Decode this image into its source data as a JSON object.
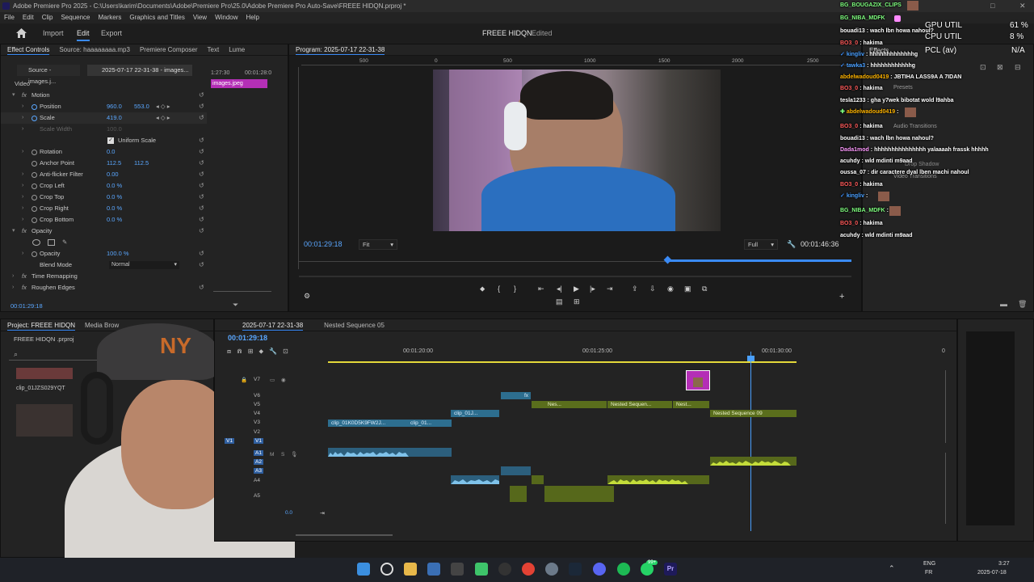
{
  "window": {
    "title": "Adobe Premiere Pro 2025 - C:\\Users\\karim\\Documents\\Adobe\\Premiere Pro\\25.0\\Adobe Premiere Pro Auto-Save\\FREEE HIDQN.prproj *"
  },
  "menu": [
    "File",
    "Edit",
    "Clip",
    "Sequence",
    "Markers",
    "Graphics and Titles",
    "View",
    "Window",
    "Help"
  ],
  "workspace": {
    "tabs": [
      "Import",
      "Edit",
      "Export"
    ],
    "active_tab": "Edit",
    "project_title": "FREEE HIDQN",
    "project_status": "Edited"
  },
  "effect_controls": {
    "tabs": [
      "Effect Controls",
      "Source: haaaaaaaa.mp3",
      "Premiere Composer",
      "Text",
      "Lume"
    ],
    "source_label": "Source - images.j...",
    "sequence_label": "2025-07-17 22-31-38 - images...",
    "ruler_times": [
      "1:27:30",
      "00:01:28:0"
    ],
    "clip_name": "images.jpeg",
    "section_video": "Video",
    "motion": "Motion",
    "rows": [
      {
        "label": "Position",
        "v1": "960.0",
        "v2": "553.0"
      },
      {
        "label": "Scale",
        "v1": "419.0",
        "v2": ""
      },
      {
        "label": "Scale Width",
        "v1": "100.0",
        "v2": ""
      },
      {
        "label": "Uniform Scale",
        "v1": "",
        "v2": ""
      },
      {
        "label": "Rotation",
        "v1": "0.0",
        "v2": ""
      },
      {
        "label": "Anchor Point",
        "v1": "112.5",
        "v2": "112.5"
      },
      {
        "label": "Anti-flicker Filter",
        "v1": "0.00",
        "v2": ""
      },
      {
        "label": "Crop Left",
        "v1": "0.0 %",
        "v2": ""
      },
      {
        "label": "Crop Top",
        "v1": "0.0 %",
        "v2": ""
      },
      {
        "label": "Crop Right",
        "v1": "0.0 %",
        "v2": ""
      },
      {
        "label": "Crop Bottom",
        "v1": "0.0 %",
        "v2": ""
      }
    ],
    "opacity_section": "Opacity",
    "opacity_label": "Opacity",
    "opacity_value": "100.0 %",
    "blend_mode_label": "Blend Mode",
    "blend_mode_value": "Normal",
    "time_remapping": "Time Remapping",
    "roughen_edges": "Roughen Edges",
    "timecode": "00:01:29:18"
  },
  "program_monitor": {
    "title": "Program: 2025-07-17 22-31-38",
    "ruler_marks": [
      "500",
      "0",
      "500",
      "1000",
      "1500",
      "2000",
      "2500"
    ],
    "timecode": "00:01:29:18",
    "fit": "Fit",
    "quality": "Full",
    "duration": "00:01:46:36"
  },
  "project_panel": {
    "tabs": [
      "Project: FREEE HIDQN",
      "Media Brow"
    ],
    "file": "FREEE HIDQN .prproj",
    "clip_label": "clip_01JZS029YQT"
  },
  "timeline": {
    "tabs": [
      "2025-07-17 22-31-38",
      "Nested Sequence 05"
    ],
    "timecode": "00:01:29:18",
    "ruler_labels": [
      "00:01:20:00",
      "00:01:25:00",
      "00:01:30:00",
      "0"
    ],
    "video_tracks": [
      "V7",
      "V6",
      "V5",
      "V4",
      "V3",
      "V2",
      "V1"
    ],
    "audio_tracks": [
      "A1",
      "A2",
      "A3",
      "A4",
      "A5"
    ],
    "master_value": "0.0",
    "clips": {
      "c1": "clip_01K0D5K9FW2J...",
      "c2": "clip_01...",
      "c3": "clip_01J...",
      "c4": "Nes...",
      "c5": "Nested Sequen...",
      "c6": "Nest...",
      "c7": "Nested Sequence 09",
      "fx": "fx"
    }
  },
  "overlay": {
    "gpu_util": "GPU UTIL",
    "gpu_val": "61 %",
    "cpu_util": "CPU UTIL",
    "cpu_val": "8 %",
    "pcl": "PCL (av)",
    "na": "N/A",
    "effects_label": "Effects",
    "presets": "Presets",
    "audio_transitions": "Audio Transitions",
    "video_transitions": "Video Transitions",
    "drop_shadow": "Drop Shadow"
  },
  "chat": [
    {
      "user": "BG_BOUGAZIX_CLIPS",
      "msg": ""
    },
    {
      "user": "BG_NIBA_MDFK",
      "msg": ""
    },
    {
      "user": "bouadi13",
      "msg": ": wach lbn howa nahoul?"
    },
    {
      "user": "BO3_0",
      "msg": ": hakima"
    },
    {
      "user": "kingliv",
      "msg": ": hhhhhhhhhhhhhg"
    },
    {
      "user": "tawka3",
      "msg": ": hhhhhhhhhhhhg"
    },
    {
      "user": "abdelwadoud0419",
      "msg": ": JBTIHA LASS9A A 7IDAN"
    },
    {
      "user": "BO3_0",
      "msg": ": hakima"
    },
    {
      "user": "tesla1233",
      "msg": ": gha y7wek bibotat wold l9ahba"
    },
    {
      "user": "abdelwadoud0419",
      "msg": ":"
    },
    {
      "user": "BO3_0",
      "msg": ": hakima"
    },
    {
      "user": "bouadi13",
      "msg": ": wach lbn howa nahoul?"
    },
    {
      "user": "Dada1mod",
      "msg": ": hhhhhhhhhhhhhhh yalaaaah frassk hhhhh"
    },
    {
      "user": "acuhdy",
      "msg": ": wld mdinti m9aad"
    },
    {
      "user": "oussa_07",
      "msg": ": dir caractere dyal lben machi nahoul"
    },
    {
      "user": "BO3_0",
      "msg": ": hakima"
    },
    {
      "user": "kingliv",
      "msg": ":"
    },
    {
      "user": "BG_NIBA_MDFK",
      "msg": ":"
    },
    {
      "user": "BO3_0",
      "msg": ": hakima"
    },
    {
      "user": "acuhdy",
      "msg": ": wld mdinti m9aad"
    }
  ],
  "taskbar": {
    "lang1": "ENG",
    "lang2": "FR",
    "time": "3:27",
    "date": "2025-07-18",
    "badge": "99+"
  },
  "colors": {
    "accent": "#3a8af5",
    "value_blue": "#5aa7ff",
    "clip_blue": "#2d6e8f",
    "clip_green": "#5a6e1c",
    "clip_magenta": "#b42fb6",
    "playhead": "#4aa0ff"
  }
}
